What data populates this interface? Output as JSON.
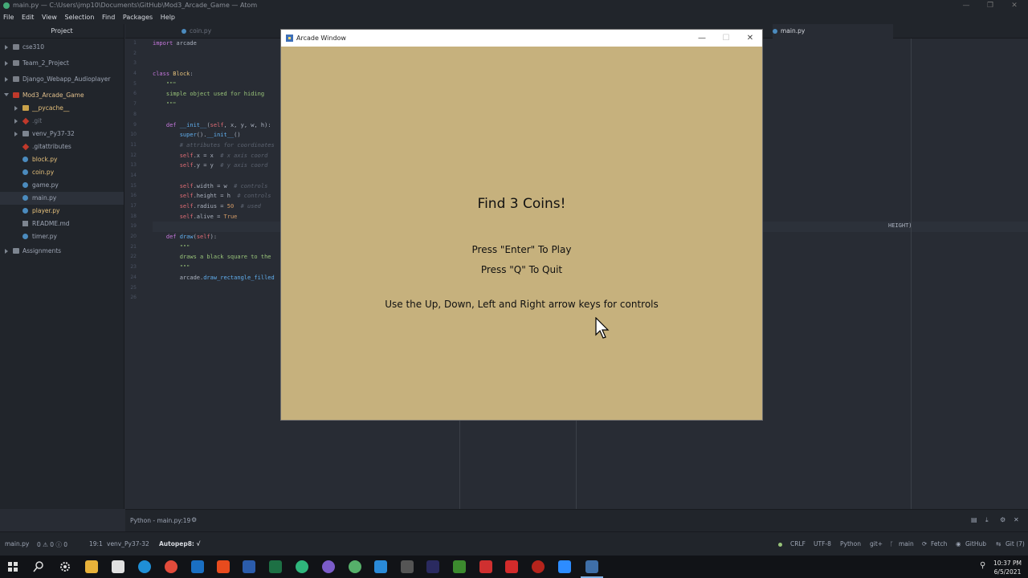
{
  "atom": {
    "window_title": "main.py — C:\\Users\\jmp10\\Documents\\GitHub\\Mod3_Arcade_Game — Atom",
    "menu": [
      "File",
      "Edit",
      "View",
      "Selection",
      "Find",
      "Packages",
      "Help"
    ],
    "window_controls": {
      "minimize": "—",
      "restore": "❐",
      "close": "✕"
    }
  },
  "tree": {
    "title": "Project",
    "items": [
      {
        "label": "cse310"
      },
      {
        "label": "Team_2_Project"
      },
      {
        "label": "Django_Webapp_Audioplayer"
      },
      {
        "label": "Mod3_Arcade_Game"
      },
      {
        "label": "__pycache__"
      },
      {
        "label": ".git"
      },
      {
        "label": "venv_Py37-32"
      },
      {
        "label": ".gitattributes"
      },
      {
        "label": "block.py"
      },
      {
        "label": "coin.py"
      },
      {
        "label": "game.py"
      },
      {
        "label": "main.py"
      },
      {
        "label": "player.py"
      },
      {
        "label": "README.md"
      },
      {
        "label": "timer.py"
      },
      {
        "label": "Assignments"
      }
    ]
  },
  "tabs": [
    {
      "label": "coin.py"
    },
    {
      "label": "main.py"
    }
  ],
  "editor": {
    "line_numbers": [
      "1",
      "2",
      "3",
      "4",
      "5",
      "6",
      "7",
      "8",
      "9",
      "10",
      "11",
      "12",
      "13",
      "14",
      "15",
      "16",
      "17",
      "18",
      "19",
      "20",
      "21",
      "22",
      "23",
      "24",
      "25",
      "26"
    ],
    "behind_text": "HEIGHT)"
  },
  "bottom_panel": {
    "label": "Python - main.py:19"
  },
  "status": {
    "file": "main.py",
    "diagnostics": "0 ⚠ 0 ⓘ 0",
    "cursor": "19:1",
    "venv": "venv_Py37-32",
    "autopep": "Autopep8: √",
    "line_ending": "CRLF",
    "encoding": "UTF-8",
    "grammar": "Python",
    "git_plus": "git+",
    "branch": "main",
    "fetch": "Fetch",
    "github": "GitHub",
    "git_count": "Git (7)"
  },
  "taskbar": {
    "time": "10:37 PM",
    "date": "6/5/2021"
  },
  "arcade": {
    "title": "Arcade Window",
    "controls": {
      "minimize": "—",
      "maximize": "☐",
      "close": "✕"
    },
    "heading": "Find 3 Coins!",
    "play": "Press \"Enter\" To Play",
    "quit": "Press \"Q\" To Quit",
    "controls_hint": "Use the Up, Down, Left and Right arrow keys for controls"
  },
  "colors": {
    "editor_bg": "#282c34",
    "panel_bg": "#21252b",
    "game_bg": "#c6b17d"
  }
}
